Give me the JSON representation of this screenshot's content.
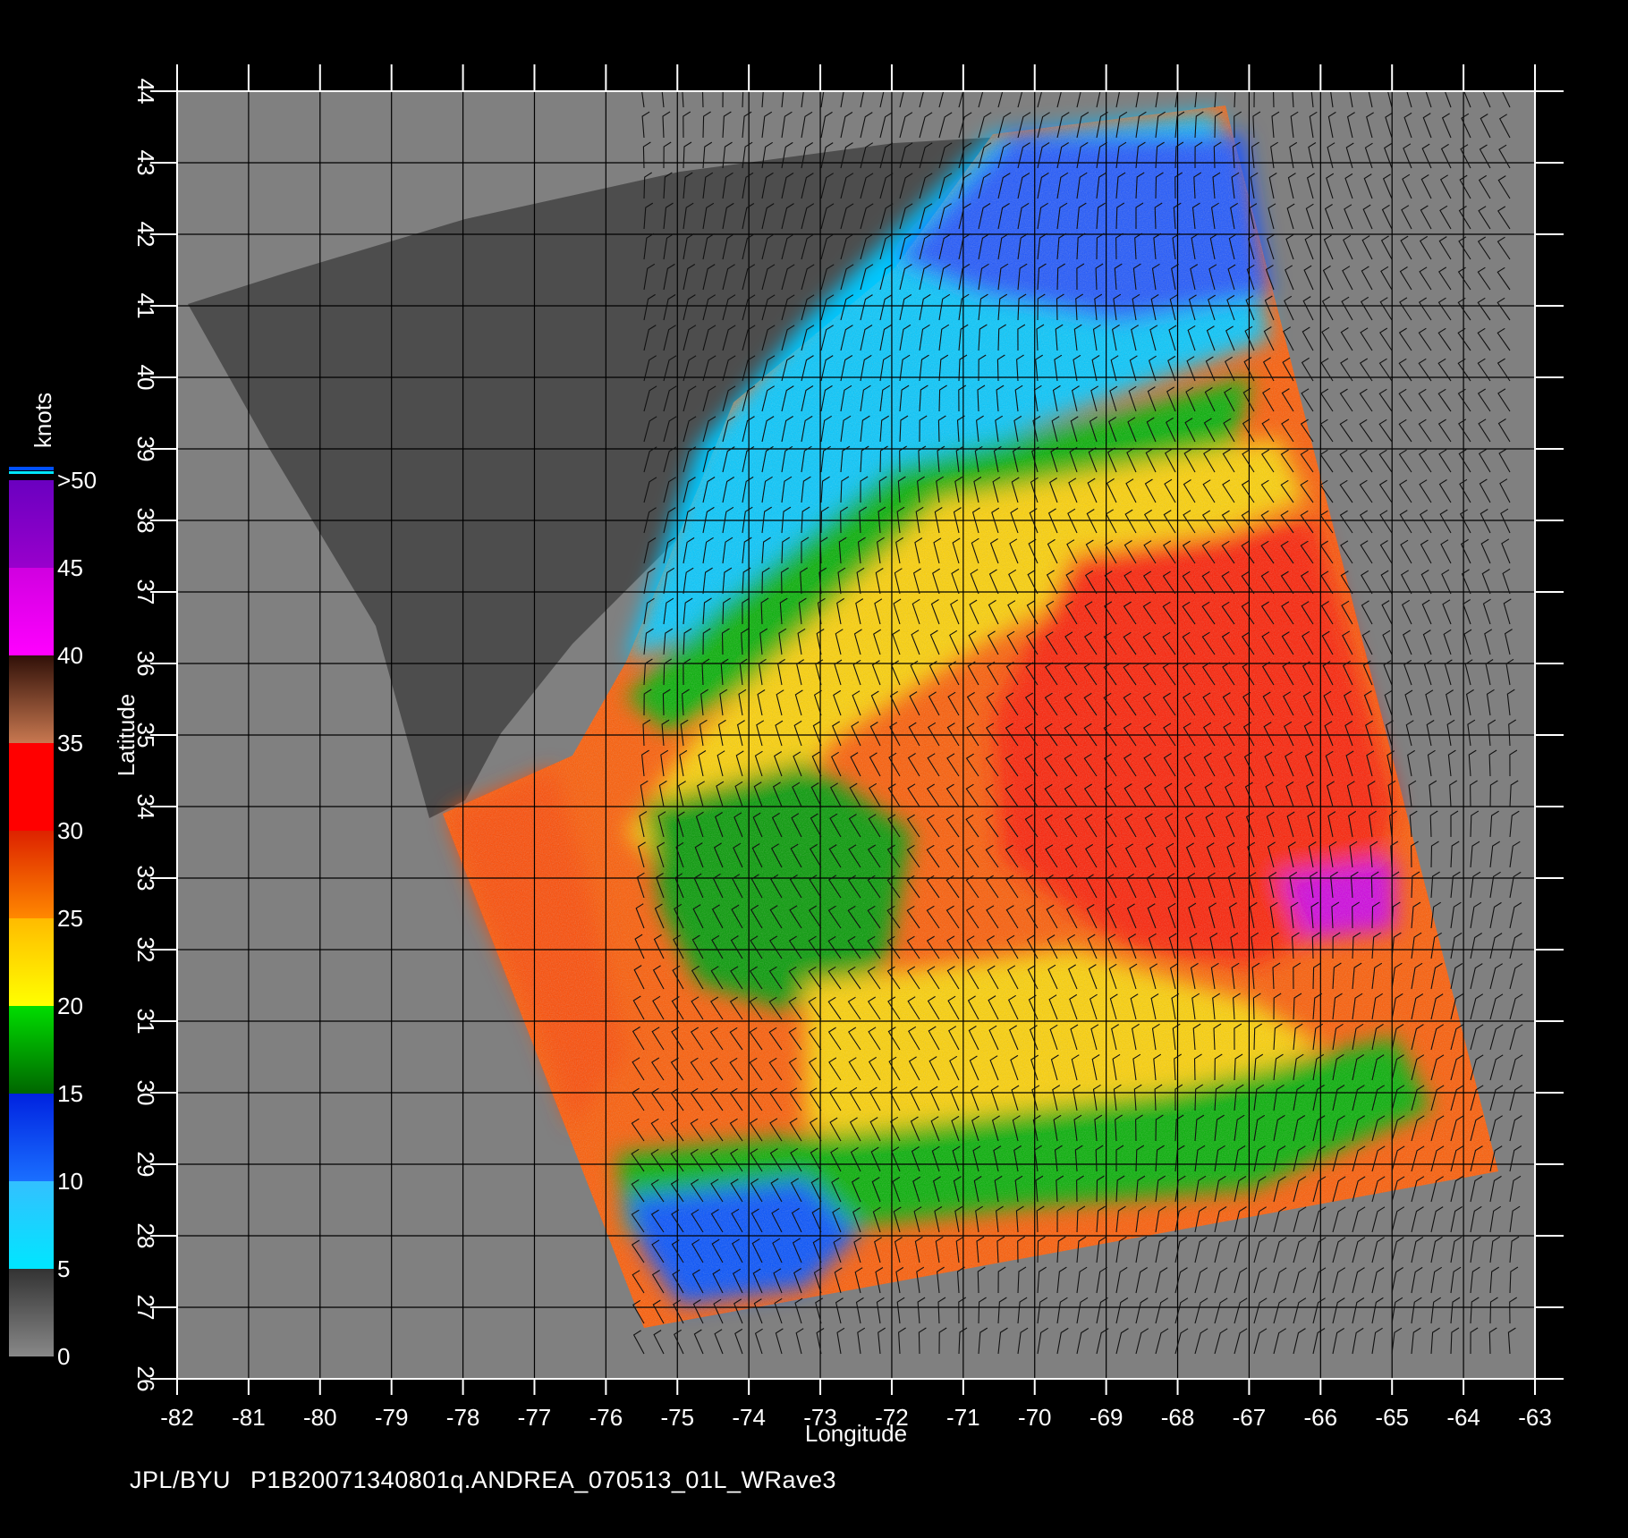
{
  "footer": {
    "source": "JPL/BYU",
    "filename": "P1B20071340801q.ANDREA_070513_01L_WRave3"
  },
  "map": {
    "x_axis_label": "Longitude",
    "y_axis_label": "Latitude",
    "lon_range": [
      -82,
      -63
    ],
    "lat_range": [
      26,
      44
    ],
    "lon_ticks": [
      "-82",
      "-81",
      "-80",
      "-79",
      "-78",
      "-77",
      "-76",
      "-75",
      "-74",
      "-73",
      "-72",
      "-71",
      "-70",
      "-69",
      "-68",
      "-67",
      "-66",
      "-65",
      "-64",
      "-63"
    ],
    "lat_ticks": [
      "26",
      "27",
      "28",
      "29",
      "30",
      "31",
      "32",
      "33",
      "34",
      "35",
      "36",
      "37",
      "38",
      "39",
      "40",
      "41",
      "42",
      "43",
      "44"
    ],
    "grid": true
  },
  "colorbar": {
    "unit_label": "knots",
    "labels": [
      "0",
      "5",
      "10",
      "15",
      "20",
      "25",
      "30",
      "35",
      "40",
      "45",
      ">50"
    ],
    "segments": [
      {
        "from": 0,
        "to": 5,
        "colors": [
          "#888888",
          "#333333"
        ]
      },
      {
        "from": 5,
        "to": 10,
        "colors": [
          "#00e6ff",
          "#33c0ff"
        ]
      },
      {
        "from": 10,
        "to": 15,
        "colors": [
          "#1a6fff",
          "#0022e0"
        ]
      },
      {
        "from": 15,
        "to": 20,
        "colors": [
          "#006600",
          "#00dd00"
        ]
      },
      {
        "from": 20,
        "to": 25,
        "colors": [
          "#ffff00",
          "#ffbb00"
        ]
      },
      {
        "from": 25,
        "to": 30,
        "colors": [
          "#ff8800",
          "#dd2200"
        ]
      },
      {
        "from": 30,
        "to": 35,
        "colors": [
          "#ff0000",
          "#ff0000"
        ]
      },
      {
        "from": 35,
        "to": 40,
        "colors": [
          "#c87850",
          "#301008"
        ]
      },
      {
        "from": 40,
        "to": 45,
        "colors": [
          "#ff00ff",
          "#d000e0"
        ]
      },
      {
        "from": 45,
        "to": 50,
        "colors": [
          "#9900cc",
          "#6a00c0"
        ]
      }
    ]
  },
  "colors": {
    "land": "#4d4d4d",
    "outside_swath": "#808080",
    "calm": "#00e6ff",
    "light": "#0044ff",
    "moderate": "#00bb00",
    "fresh": "#ffe600",
    "strong": "#ff5a00",
    "gale": "#ff1a00",
    "storm": "#d000e0"
  }
}
